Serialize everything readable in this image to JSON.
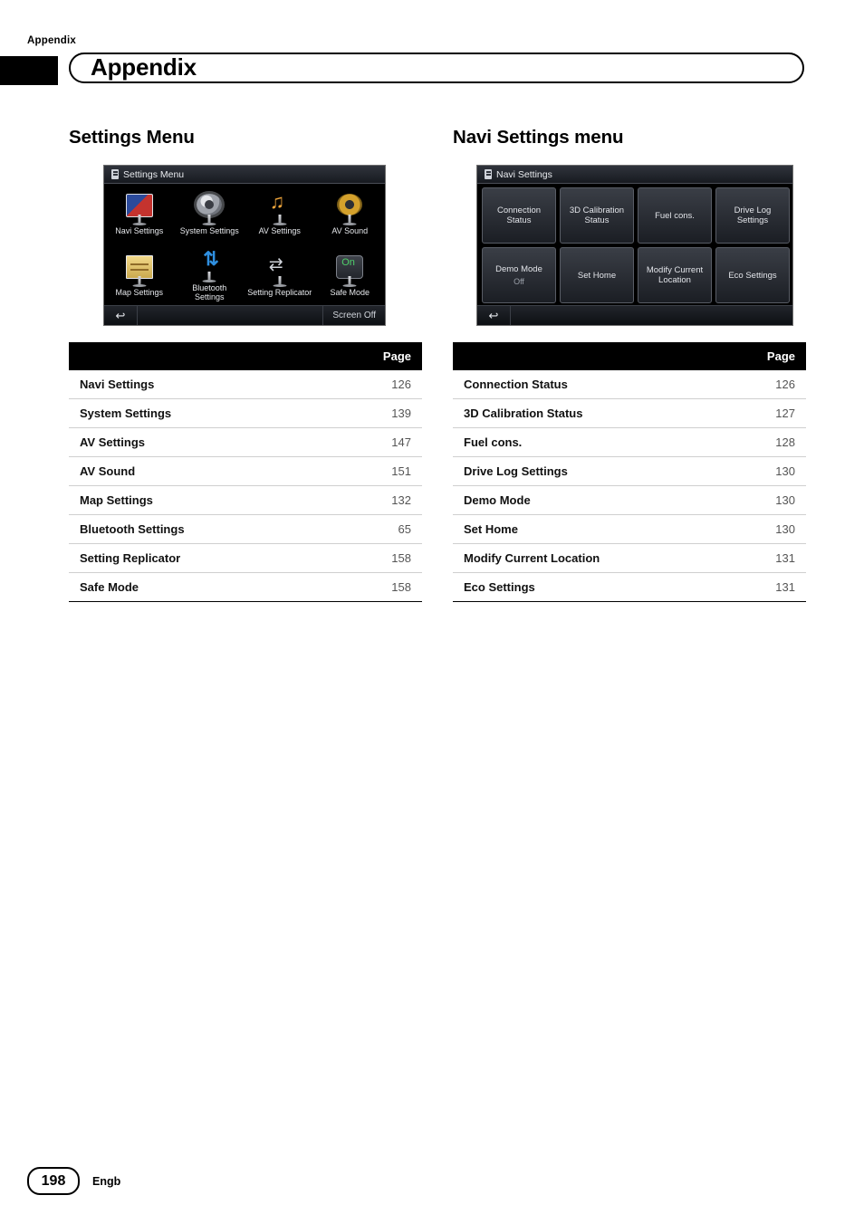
{
  "header": {
    "breadcrumb": "Appendix",
    "title": "Appendix"
  },
  "left": {
    "section_title": "Settings Menu",
    "device": {
      "title": "Settings Menu",
      "screen_off_label": "Screen Off",
      "back_glyph": "↩",
      "items": [
        {
          "label": "Navi Settings",
          "icon": "flag-icon"
        },
        {
          "label": "System Settings",
          "icon": "gear-icon"
        },
        {
          "label": "AV Settings",
          "icon": "music-note-icon"
        },
        {
          "label": "AV Sound",
          "icon": "speaker-icon"
        },
        {
          "label": "Map Settings",
          "icon": "map-icon"
        },
        {
          "label": "Bluetooth Settings",
          "icon": "bluetooth-icon"
        },
        {
          "label": "Setting Replicator",
          "icon": "replicator-icon"
        },
        {
          "label": "Safe Mode",
          "icon": "on-switch-icon"
        }
      ]
    },
    "table": {
      "headers": [
        "",
        "Page"
      ],
      "rows": [
        {
          "name": "Navi Settings",
          "page": "126"
        },
        {
          "name": "System Settings",
          "page": "139"
        },
        {
          "name": "AV Settings",
          "page": "147"
        },
        {
          "name": "AV Sound",
          "page": "151"
        },
        {
          "name": "Map Settings",
          "page": "132"
        },
        {
          "name": "Bluetooth Settings",
          "page": "65"
        },
        {
          "name": "Setting Replicator",
          "page": "158"
        },
        {
          "name": "Safe Mode",
          "page": "158"
        }
      ]
    }
  },
  "right": {
    "section_title_a": "Navi Settings ",
    "section_title_b": "menu",
    "device": {
      "title": "Navi Settings",
      "back_glyph": "↩",
      "buttons": [
        {
          "label": "Connection Status",
          "sub": ""
        },
        {
          "label": "3D Calibration Status",
          "sub": ""
        },
        {
          "label": "Fuel cons.",
          "sub": ""
        },
        {
          "label": "Drive Log Settings",
          "sub": ""
        },
        {
          "label": "Demo Mode",
          "sub": "Off"
        },
        {
          "label": "Set Home",
          "sub": ""
        },
        {
          "label": "Modify Current Location",
          "sub": ""
        },
        {
          "label": "Eco Settings",
          "sub": ""
        }
      ]
    },
    "table": {
      "headers": [
        "",
        "Page"
      ],
      "rows": [
        {
          "name": "Connection Status",
          "page": "126"
        },
        {
          "name": "3D Calibration Status",
          "page": "127"
        },
        {
          "name": "Fuel cons.",
          "page": "128"
        },
        {
          "name": "Drive Log Settings",
          "page": "130"
        },
        {
          "name": "Demo Mode",
          "page": "130"
        },
        {
          "name": "Set Home",
          "page": "130"
        },
        {
          "name": "Modify Current Location",
          "page": "131"
        },
        {
          "name": "Eco Settings",
          "page": "131"
        }
      ]
    }
  },
  "footer": {
    "page_number": "198",
    "language": "Engb"
  }
}
